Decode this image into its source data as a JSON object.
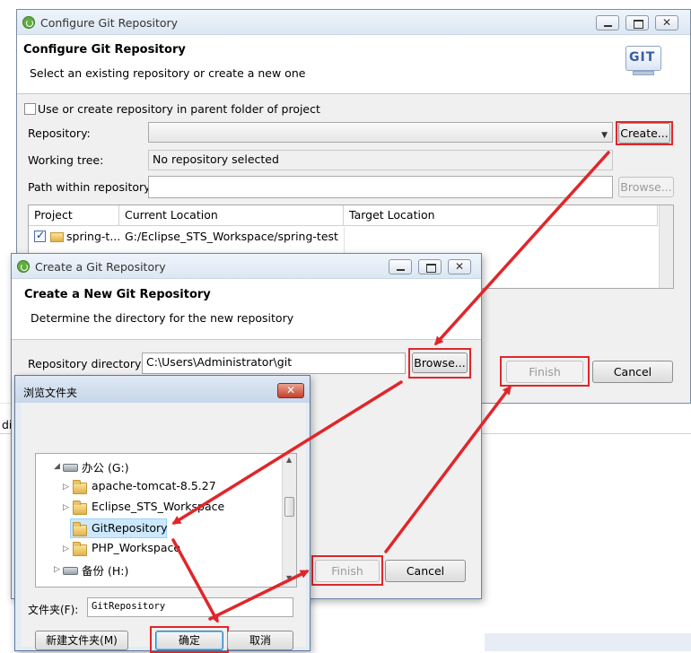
{
  "configure_window": {
    "title": "Configure Git Repository",
    "header_title": "Configure Git Repository",
    "header_desc": "Select an existing repository or create a new one",
    "git_logo_text": "GIT",
    "use_parent_label": "Use or create repository in parent folder of project",
    "repository_label": "Repository:",
    "create_button": "Create...",
    "working_tree_label": "Working tree:",
    "working_tree_value": "No repository selected",
    "path_label": "Path within repository:",
    "browse_button": "Browse...",
    "table_headers": [
      "Project",
      "Current Location",
      "Target Location"
    ],
    "table_row": {
      "project": "spring-t...",
      "current": "G:/Eclipse_STS_Workspace/spring-test",
      "target": ""
    },
    "finish_button": "Finish",
    "cancel_button": "Cancel"
  },
  "create_window": {
    "title": "Create a Git Repository",
    "header_title": "Create a New Git Repository",
    "header_desc": "Determine the directory for the new repository",
    "repo_dir_label": "Repository directory:",
    "repo_dir_value": "C:\\Users\\Administrator\\git",
    "browse_button": "Browse...",
    "finish_button": "Finish",
    "cancel_button": "Cancel"
  },
  "folder_dialog": {
    "title": "浏览文件夹",
    "close_glyph": "✕",
    "tree": [
      {
        "label": "办公 (G:)",
        "type": "drive",
        "arrow": "◢"
      },
      {
        "label": "apache-tomcat-8.5.27",
        "type": "folder",
        "arrow": "▷"
      },
      {
        "label": "Eclipse_STS_Workspace",
        "type": "folder",
        "arrow": "▷"
      },
      {
        "label": "GitRepository",
        "type": "folder",
        "arrow": ""
      },
      {
        "label": "PHP_Workspace",
        "type": "folder",
        "arrow": "▷"
      },
      {
        "label": "备份 (H:)",
        "type": "drive",
        "arrow": "▷"
      }
    ],
    "folder_label": "文件夹(F):",
    "folder_value": "GitRepository",
    "new_folder_button": "新建文件夹(M)",
    "ok_button": "确定",
    "cancel_button": "取消"
  },
  "background": {
    "left_fragment": "di"
  },
  "colors": {
    "highlight": "#e0262a",
    "selection": "#cce8ff"
  }
}
